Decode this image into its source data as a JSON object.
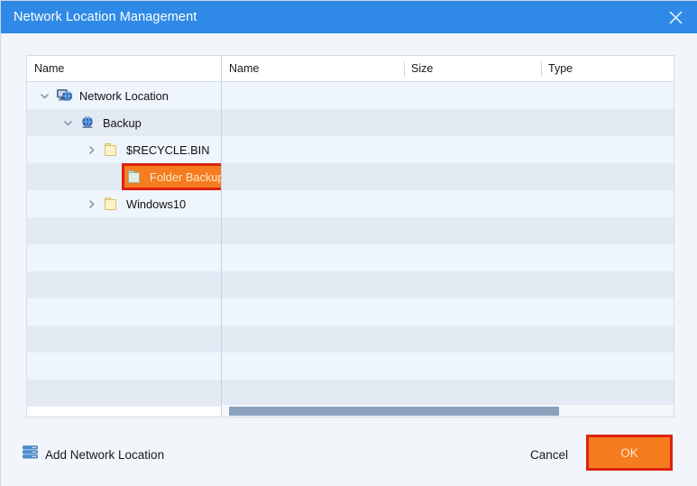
{
  "window": {
    "title": "Network Location Management",
    "close_icon": "close-icon",
    "titlebar_color": "#2e8ae6"
  },
  "left_panel": {
    "column_header": "Name",
    "tree": [
      {
        "label": "Network Location",
        "depth": 0,
        "expander": "chevron-down-icon",
        "icon": "network-computer-icon",
        "selected": false
      },
      {
        "label": "Backup",
        "depth": 1,
        "expander": "chevron-down-icon",
        "icon": "network-globe-icon",
        "selected": false
      },
      {
        "label": "$RECYCLE.BIN",
        "depth": 2,
        "expander": "chevron-right-icon",
        "icon": "folder-icon",
        "selected": false
      },
      {
        "label": "Folder Backup",
        "depth": 2,
        "expander": "",
        "icon": "folder-icon",
        "selected": true
      },
      {
        "label": "Windows10",
        "depth": 2,
        "expander": "chevron-right-icon",
        "icon": "folder-icon",
        "selected": false
      }
    ]
  },
  "right_panel": {
    "columns": [
      {
        "label": "Name"
      },
      {
        "label": "Size"
      },
      {
        "label": "Type"
      }
    ],
    "rows": [],
    "scrollbar": {
      "orientation": "horizontal",
      "thumb_fraction": 0.755
    }
  },
  "footer": {
    "add_network_location": {
      "label": "Add Network Location",
      "icon": "server-stack-icon"
    },
    "cancel_label": "Cancel",
    "ok_label": "OK"
  },
  "highlight": {
    "fill_color": "#f57c1f",
    "border_color": "#dd2310"
  }
}
